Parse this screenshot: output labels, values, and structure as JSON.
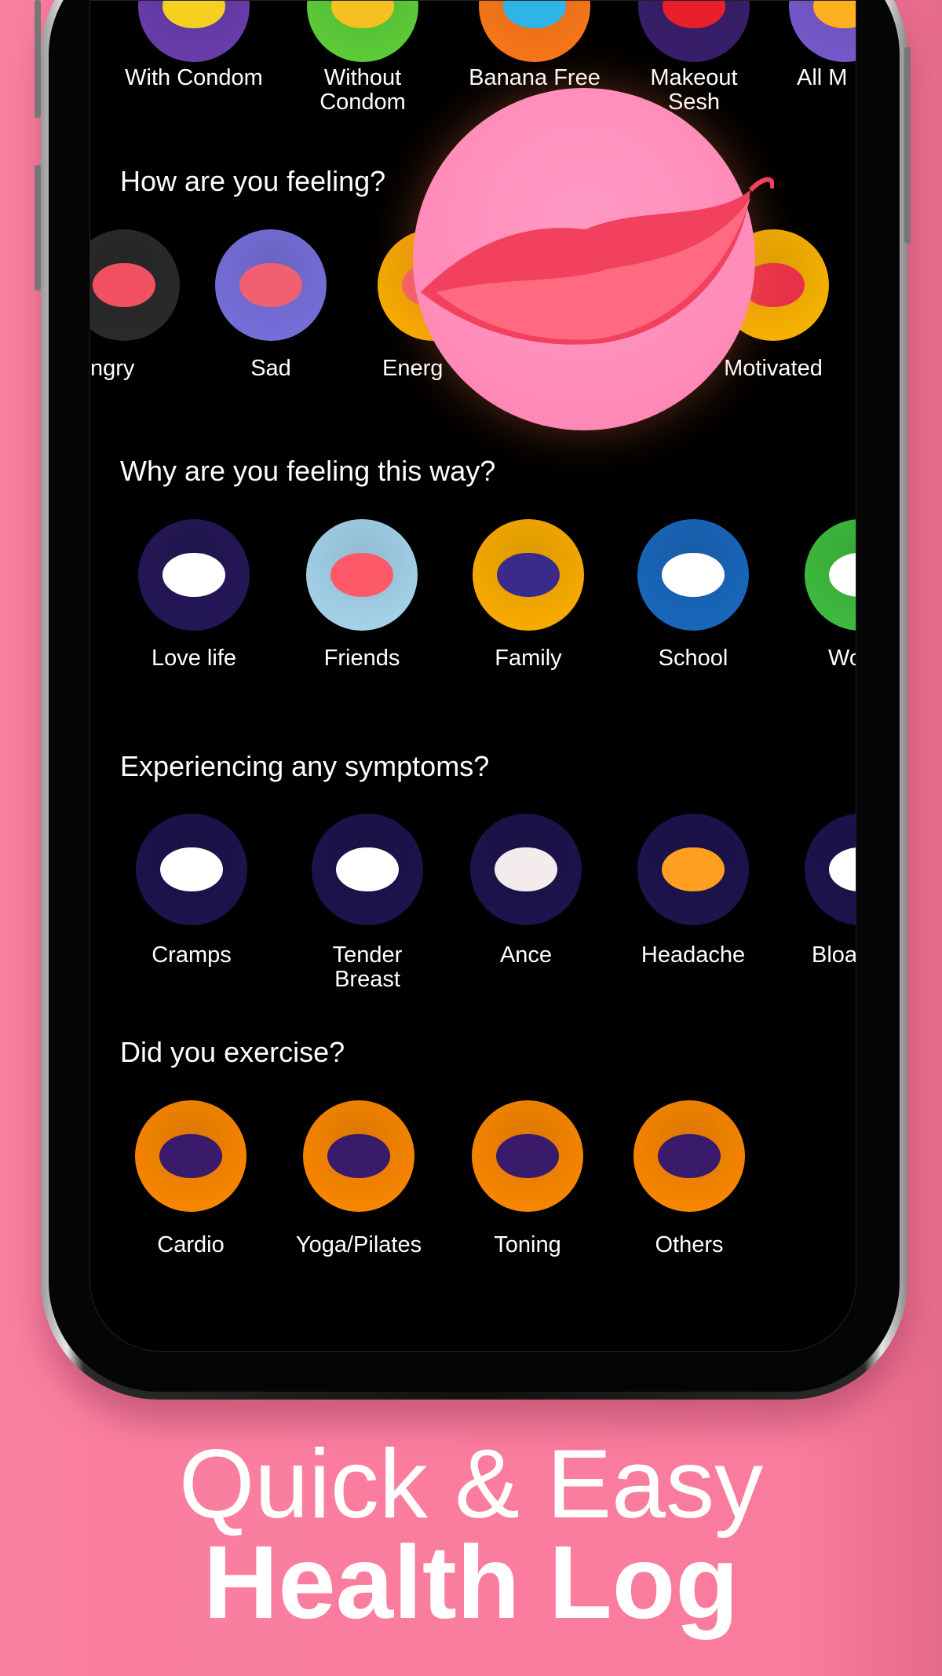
{
  "colors": {
    "background": "#f97b9e",
    "screen": "#000000",
    "text": "#ffffff"
  },
  "sections": [
    {
      "title": "",
      "items": [
        {
          "label": "With Condom",
          "icon": "banana-condom-icon",
          "color": "#6b3fb0",
          "accent": "#f5d020"
        },
        {
          "label": "Without\nCondom",
          "icon": "rainbow-banana-icon",
          "color": "#5fd23a",
          "accent": "#f5c020"
        },
        {
          "label": "Banana Free",
          "icon": "peach-icon",
          "color": "#ff7a1a",
          "accent": "#2fb4e8"
        },
        {
          "label": "Makeout\nSesh",
          "icon": "strawberry-icon",
          "color": "#3a1f6e",
          "accent": "#e8202a"
        },
        {
          "label": "All M",
          "icon": "all-icon",
          "color": "#7a5ad0",
          "accent": "#ffb020"
        }
      ]
    },
    {
      "title": "How are you feeling?",
      "items": [
        {
          "label": "ngry",
          "icon": "angry-mouth-icon",
          "color": "#2b2b2b",
          "accent": "#f05060"
        },
        {
          "label": "Sad",
          "icon": "sad-mouth-icon",
          "color": "#7a72e0",
          "accent": "#f06070"
        },
        {
          "label": "Energ",
          "icon": "energetic-mouth-icon",
          "color": "#ffb300",
          "accent": "#f06070"
        },
        {
          "label": "Motivated",
          "icon": "motivated-mouth-icon",
          "color": "#ffb800",
          "accent": "#e8304a"
        }
      ]
    },
    {
      "title": "Why are you feeling this way?",
      "items": [
        {
          "label": "Love life",
          "icon": "holding-hands-icon",
          "color": "#26185a",
          "accent": "#ffffff"
        },
        {
          "label": "Friends",
          "icon": "cheers-cups-icon",
          "color": "#a8d8f0",
          "accent": "#ff5a6a"
        },
        {
          "label": "Family",
          "icon": "family-photo-icon",
          "color": "#ffb000",
          "accent": "#3a2a8a"
        },
        {
          "label": "School",
          "icon": "open-book-icon",
          "color": "#1a6ac0",
          "accent": "#ffffff"
        },
        {
          "label": "Wo",
          "icon": "laptop-icon",
          "color": "#40c040",
          "accent": "#ffffff"
        }
      ]
    },
    {
      "title": "Experiencing any symptoms?",
      "items": [
        {
          "label": "Cramps",
          "icon": "cramps-icon",
          "color": "#1e1450",
          "accent": "#ffffff"
        },
        {
          "label": "Tender\nBreast",
          "icon": "tender-breast-icon",
          "color": "#1e1450",
          "accent": "#ffffff"
        },
        {
          "label": "Ance",
          "icon": "acne-icon",
          "color": "#1e1450",
          "accent": "#f4ecec"
        },
        {
          "label": "Headache",
          "icon": "headache-lightning-icon",
          "color": "#1e1450",
          "accent": "#ffa020"
        },
        {
          "label": "Bloa",
          "icon": "bloating-icon",
          "color": "#1e1450",
          "accent": "#ffffff"
        }
      ]
    },
    {
      "title": "Did you exercise?",
      "items": [
        {
          "label": "Cardio",
          "icon": "runner-icon",
          "color": "#ff8a00",
          "accent": "#3a1a6a"
        },
        {
          "label": "Yoga/Pilates",
          "icon": "yoga-pose-icon",
          "color": "#ff8a00",
          "accent": "#3a1a6a"
        },
        {
          "label": "Toning",
          "icon": "dumbbell-figure-icon",
          "color": "#ff8a00",
          "accent": "#3a1a6a"
        },
        {
          "label": "Others",
          "icon": "drinking-figure-icon",
          "color": "#ff8a00",
          "accent": "#3a1a6a"
        }
      ]
    }
  ],
  "popup": {
    "icon": "lips-icon",
    "color": "#ff8ab8"
  },
  "headline": {
    "line1": "Quick & Easy",
    "line2": "Health Log"
  }
}
